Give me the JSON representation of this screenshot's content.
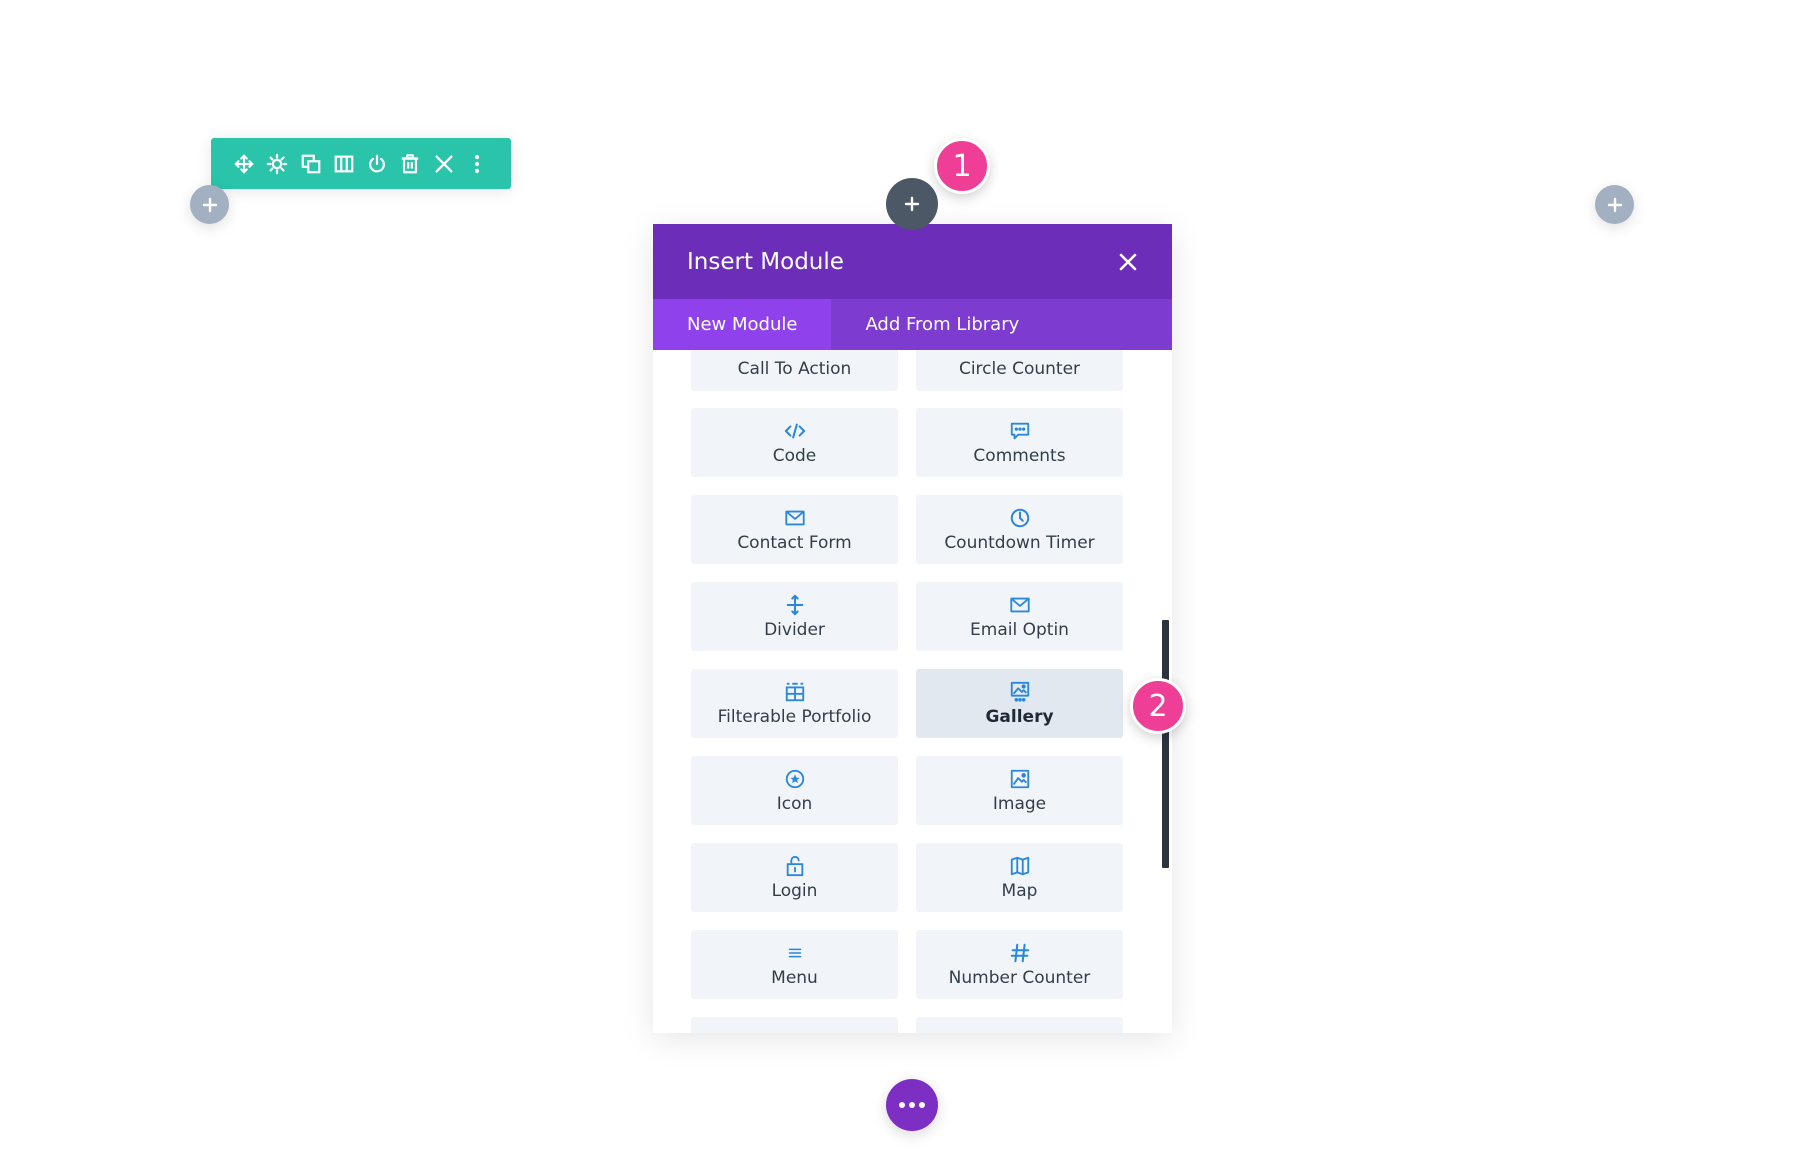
{
  "colors": {
    "row_toolbar": "#29c4a9",
    "modal_header": "#6c2eb9",
    "tabs_bar": "#7d3bcf",
    "active_tab": "#8f42ec",
    "icon_blue": "#2b87da",
    "badge_pink": "#ef3e96",
    "more_button": "#7d2fc4"
  },
  "row_toolbar": {
    "icons": [
      "move-icon",
      "gear-icon",
      "duplicate-icon",
      "columns-icon",
      "power-icon",
      "trash-icon",
      "close-icon",
      "more-vertical-icon"
    ]
  },
  "badges": {
    "step1": "1",
    "step2": "2"
  },
  "modal": {
    "title": "Insert Module",
    "tabs": [
      {
        "label": "New Module",
        "active": true
      },
      {
        "label": "Add From Library",
        "active": false
      }
    ],
    "modules": [
      {
        "label": "Call To Action",
        "icon": "call-to-action-icon"
      },
      {
        "label": "Circle Counter",
        "icon": "circle-counter-icon"
      },
      {
        "label": "Code",
        "icon": "code-icon"
      },
      {
        "label": "Comments",
        "icon": "comments-icon"
      },
      {
        "label": "Contact Form",
        "icon": "envelope-icon"
      },
      {
        "label": "Countdown Timer",
        "icon": "clock-icon"
      },
      {
        "label": "Divider",
        "icon": "divider-icon"
      },
      {
        "label": "Email Optin",
        "icon": "envelope-icon"
      },
      {
        "label": "Filterable Portfolio",
        "icon": "portfolio-grid-icon"
      },
      {
        "label": "Gallery",
        "icon": "gallery-icon",
        "highlighted": true
      },
      {
        "label": "Icon",
        "icon": "star-circle-icon"
      },
      {
        "label": "Image",
        "icon": "image-icon"
      },
      {
        "label": "Login",
        "icon": "lock-icon"
      },
      {
        "label": "Map",
        "icon": "map-icon"
      },
      {
        "label": "Menu",
        "icon": "menu-icon"
      },
      {
        "label": "Number Counter",
        "icon": "hash-icon"
      }
    ]
  }
}
